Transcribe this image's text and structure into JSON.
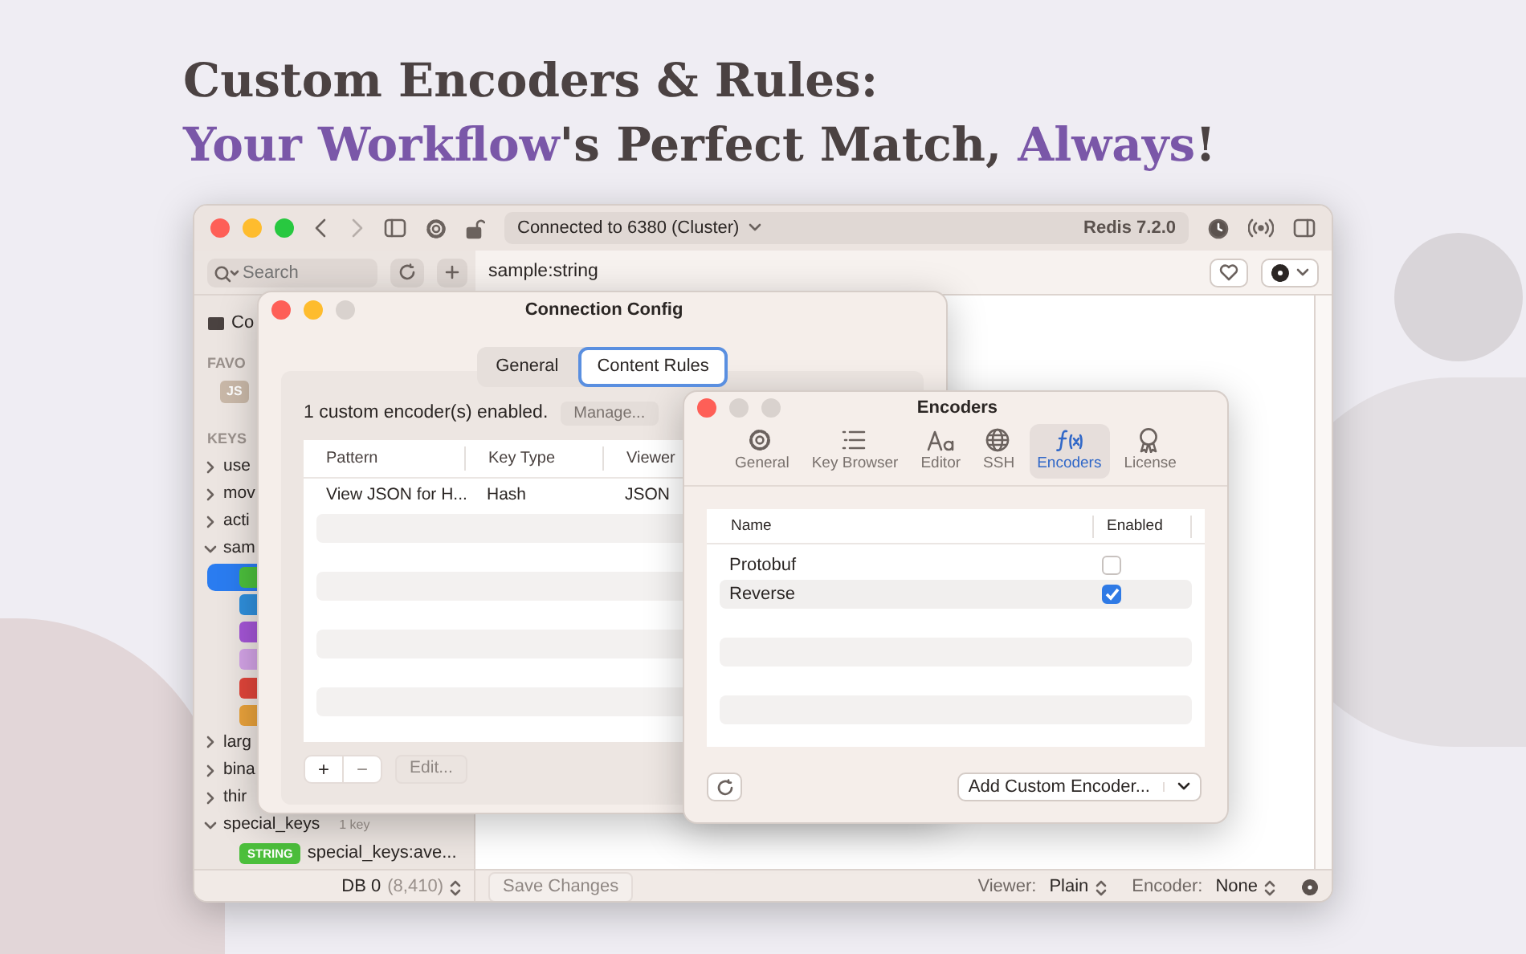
{
  "headline": {
    "line_1": "Custom Encoders & Rules:",
    "line_2": [
      {
        "text": "Your Workflow",
        "accent": true
      },
      {
        "text": "'s Perfect Match, ",
        "accent": false
      },
      {
        "text": "Always",
        "accent": true
      },
      {
        "text": "!",
        "accent": false
      }
    ]
  },
  "main_window": {
    "connection": "Connected to 6380 (Cluster)",
    "server_version": "Redis 7.2.0",
    "search": {
      "placeholder": "Search"
    },
    "key_name": "sample:string",
    "sidebar": {
      "connection_label": "Co",
      "favorites_header": "FAVO",
      "favorites": [
        {
          "badge": "JS"
        }
      ],
      "keys_header": "KEYS",
      "groups": [
        {
          "label": "use",
          "expanded": false
        },
        {
          "label": "mov",
          "expanded": false
        },
        {
          "label": "acti",
          "expanded": false
        },
        {
          "label": "sam",
          "expanded": true,
          "children": [
            {
              "color": "#4cbf3c",
              "selected": true
            },
            {
              "color": "#2f8fdc",
              "selected": false
            },
            {
              "color": "#a455d6",
              "selected": false
            },
            {
              "color": "#d3a3e6",
              "selected": false
            },
            {
              "color": "#e0453a",
              "selected": false
            },
            {
              "color": "#e9a23b",
              "selected": false
            }
          ]
        },
        {
          "label": "larg",
          "expanded": false
        },
        {
          "label": "bina",
          "expanded": false
        },
        {
          "label": "thir",
          "expanded": false
        },
        {
          "label": "special_keys",
          "count": "1 key",
          "expanded": true,
          "children": [
            {
              "badge": "STRING",
              "color": "#4cbf3c",
              "label": "special_keys:ave...",
              "selected": false
            }
          ]
        }
      ]
    },
    "status_bar": {
      "db": "DB 0",
      "key_count": "(8,410)",
      "save_button": {
        "label": "Save Changes",
        "disabled": true
      },
      "viewer_label": "Viewer:",
      "viewer": "Plain",
      "encoder_label": "Encoder:",
      "encoder": "None"
    }
  },
  "connection_config": {
    "title": "Connection Config",
    "tabs": [
      {
        "label": "General",
        "selected": false
      },
      {
        "label": "Content Rules",
        "selected": true
      }
    ],
    "summary": "1 custom encoder(s) enabled.",
    "manage_button": "Manage...",
    "columns": [
      "Pattern",
      "Key Type",
      "Viewer"
    ],
    "rows": [
      [
        "View JSON for H...",
        "Hash",
        "JSON"
      ]
    ],
    "add_button": {
      "label": "+",
      "disabled": false
    },
    "remove_button": {
      "label": "−",
      "disabled": true
    },
    "edit_button": {
      "label": "Edit...",
      "disabled": true
    }
  },
  "encoders_window": {
    "title": "Encoders",
    "tabs": [
      {
        "label": "General",
        "selected": false
      },
      {
        "label": "Key Browser",
        "selected": false
      },
      {
        "label": "Editor",
        "selected": false
      },
      {
        "label": "SSH",
        "selected": false
      },
      {
        "label": "Encoders",
        "selected": true
      },
      {
        "label": "License",
        "selected": false
      }
    ],
    "columns": [
      "Name",
      "Enabled"
    ],
    "rows": [
      {
        "name": "Protobuf",
        "enabled": false,
        "selected": false
      },
      {
        "name": "Reverse",
        "enabled": true,
        "selected": true
      }
    ],
    "add_button": "Add Custom Encoder..."
  }
}
